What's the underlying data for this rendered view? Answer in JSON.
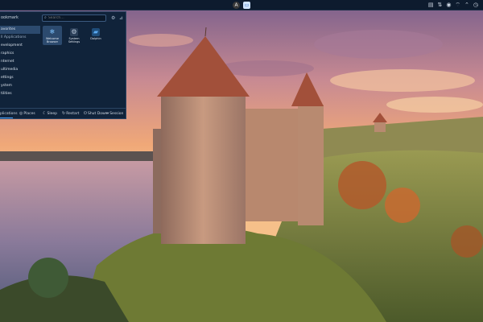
{
  "taskbar": {
    "running_apps": [
      {
        "icon": "user-icon",
        "glyph": "A",
        "bg": "#3a3a3a"
      },
      {
        "icon": "file-manager-icon",
        "glyph": "▭",
        "bg": "#cfe3ff"
      }
    ],
    "tray": [
      {
        "icon": "clipboard-icon",
        "glyph": "▤"
      },
      {
        "icon": "network-icon",
        "glyph": "⇅"
      },
      {
        "icon": "volume-icon",
        "glyph": "◉"
      },
      {
        "icon": "wifi-icon",
        "glyph": "⌔"
      },
      {
        "icon": "chevron-up-icon",
        "glyph": "⌃"
      },
      {
        "icon": "clock-icon",
        "glyph": "◷"
      }
    ]
  },
  "launcher": {
    "header_label": "ookmark",
    "search_placeholder": "Search…",
    "categories": [
      {
        "label": "avorites",
        "active": true
      },
      {
        "label": "ll Applications",
        "active": false
      },
      {
        "label": "evelopment",
        "active": false
      },
      {
        "label": "raphics",
        "active": false
      },
      {
        "label": "nternet",
        "active": false
      },
      {
        "label": "ultimedia",
        "active": false
      },
      {
        "label": "ettings",
        "active": false
      },
      {
        "label": "ystem",
        "active": false
      },
      {
        "label": "tilities",
        "active": false
      }
    ],
    "apps": [
      {
        "label": "Welcome Browser",
        "icon": "snowflake-icon",
        "glyph": "❄",
        "color": "#7fc4ff",
        "selected": true
      },
      {
        "label": "System Settings",
        "icon": "settings-icon",
        "glyph": "⚙",
        "color": "#b8c7d8",
        "selected": false
      },
      {
        "label": "Dolphin",
        "icon": "folder-icon",
        "glyph": "▰",
        "color": "#5aa9f0",
        "selected": false
      }
    ],
    "footer": [
      {
        "label": "plications",
        "glyph": "",
        "icon": "apps-icon"
      },
      {
        "label": "Places",
        "glyph": "◎",
        "icon": "places-icon"
      },
      {
        "label": "Sleep",
        "glyph": "☾",
        "icon": "sleep-icon"
      },
      {
        "label": "Restart",
        "glyph": "↻",
        "icon": "restart-icon"
      },
      {
        "label": "Shut Down",
        "glyph": "⏻",
        "icon": "shutdown-icon"
      },
      {
        "label": "Session",
        "glyph": "⇥",
        "icon": "session-icon"
      }
    ]
  },
  "colors": {
    "panel_bg": "#0d1b2e",
    "launcher_bg": "#10233a",
    "accent": "#4aa3ff"
  }
}
